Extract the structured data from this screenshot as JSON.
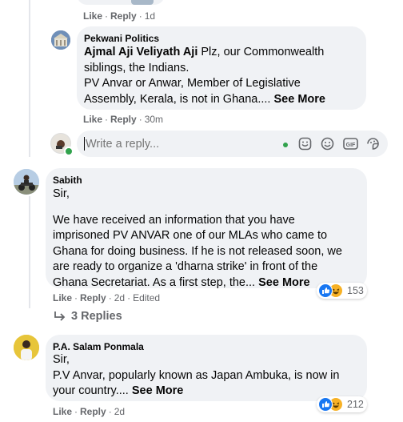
{
  "top_meta": {
    "like": "Like",
    "reply": "Reply",
    "time": "1d"
  },
  "reply1": {
    "author": "Pekwani Politics",
    "mention": "Ajmal Aji Veliyath Aji",
    "line1_rest": " Plz, our Commonwealth",
    "line2": "siblings, the Indians.",
    "line3": "PV Anvar or Anwar, Member of Legislative",
    "line4": "Assembly, Kerala, is not in Ghana....",
    "see_more": "See More",
    "like": "Like",
    "reply": "Reply",
    "time": "30m"
  },
  "reply_input": {
    "placeholder": "Write a reply..."
  },
  "comment1": {
    "author": "Sabith",
    "greeting": "Sir,",
    "lines": [
      "We have received an information that you have",
      "imprisoned PV ANVAR one of our MLAs who came to",
      "Ghana for doing business. If he is not released soon, we",
      "are ready to organize a 'dharna strike' in front of the"
    ],
    "last_line": "Ghana Secretariat. As a first step, the...",
    "see_more": "See More",
    "reaction_count": "153",
    "like": "Like",
    "reply": "Reply",
    "time": "2d",
    "edited": "Edited",
    "replies_label": "3 Replies"
  },
  "comment2": {
    "author": "P.A. Salam Ponmala",
    "greeting": "Sir,",
    "line1": "P.V Anvar, popularly known as Japan Ambuka, is now in",
    "line2": "your country....",
    "see_more": "See More",
    "reaction_count": "212",
    "like": "Like",
    "reply": "Reply",
    "time": "2d"
  },
  "colors": {
    "bubble": "#f0f2f5",
    "meta": "#65676b",
    "like_blue": "#1877f2",
    "haha_yellow": "#f7b125",
    "online_green": "#31a24c"
  }
}
